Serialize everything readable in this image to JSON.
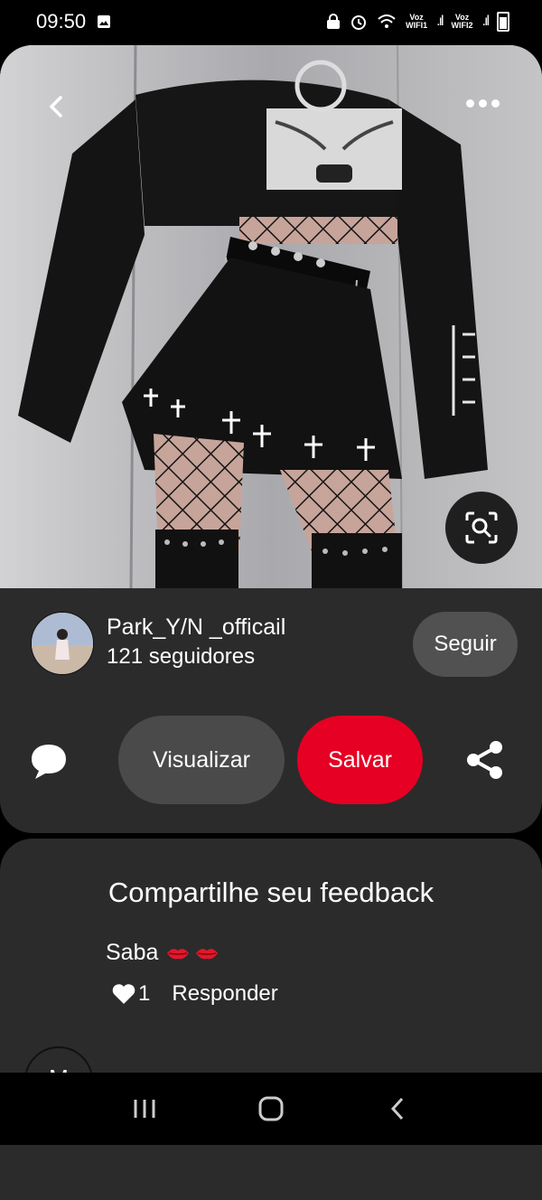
{
  "status_bar": {
    "time": "09:50",
    "net1": "Voz\nWIFI1",
    "net2": "Voz\nWIFI2"
  },
  "icons": {
    "back": "chevron-left-icon",
    "more": "more-horizontal-icon",
    "lens": "visual-search-icon",
    "comment": "speech-bubble-icon",
    "share": "share-icon",
    "like": "heart-icon"
  },
  "pin": {
    "creator": {
      "name": "Park_Y/N _officail",
      "followers": "121 seguidores"
    },
    "follow_label": "Seguir",
    "view_label": "Visualizar",
    "save_label": "Salvar"
  },
  "feedback": {
    "title": "Compartilhe seu feedback",
    "comment": {
      "author_text": "Saba",
      "emoji": "💋💋",
      "like_count": "1",
      "reply_label": "Responder"
    },
    "next_avatar_letter": "M"
  },
  "colors": {
    "save_red": "#e60023",
    "card_bg": "#2b2b2b",
    "button_gray": "#4a4a4a"
  }
}
